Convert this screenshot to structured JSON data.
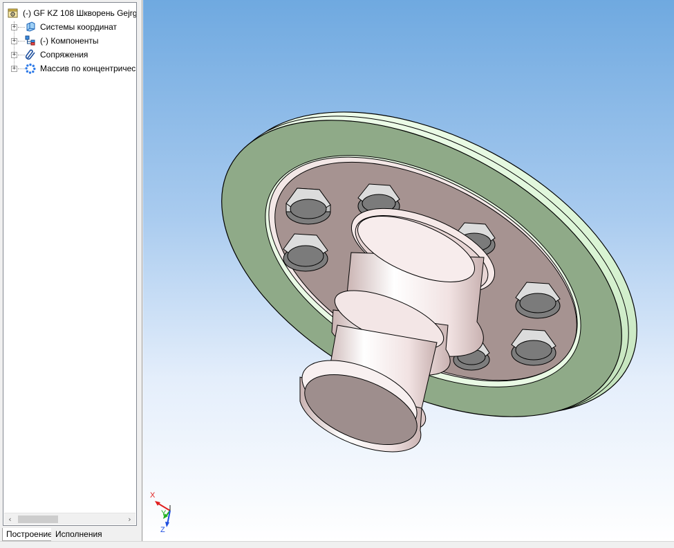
{
  "tree": {
    "root": {
      "label": "(-) GF KZ 108 Шкворень Gejrg",
      "icon": "assembly-icon"
    },
    "items": [
      {
        "label": "Системы координат",
        "icon": "coordinate-system-icon"
      },
      {
        "label": "(-) Компоненты",
        "icon": "components-icon"
      },
      {
        "label": "Сопряжения",
        "icon": "mates-icon"
      },
      {
        "label": "Массив по концентричес",
        "icon": "circular-pattern-icon"
      }
    ],
    "expander": "+"
  },
  "scrollbar": {
    "left_arrow": "‹",
    "right_arrow": "›"
  },
  "tabs": [
    {
      "label": "Построение",
      "active": true
    },
    {
      "label": "Исполнения",
      "active": false
    }
  ],
  "axes": {
    "x": "X",
    "y": "Y",
    "z": "Z"
  },
  "colors": {
    "viewport_top": "#6fa9e0",
    "disk_green": "#8faa88",
    "disk_light": "#e9f9e4",
    "plate": "#a69391",
    "pin": "#f4e6e6",
    "bolt": "#7d7d7d",
    "axis_x": "#e02020",
    "axis_y": "#20b020",
    "axis_z": "#2050e0"
  }
}
